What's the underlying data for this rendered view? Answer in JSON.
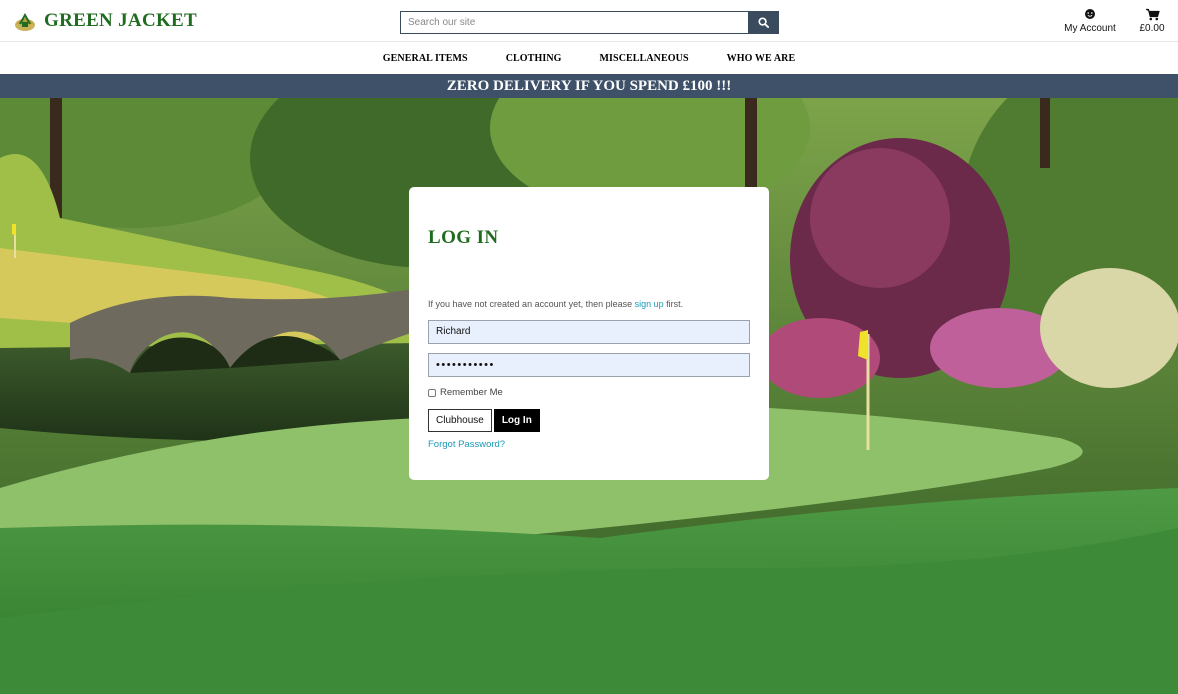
{
  "brand": {
    "name": "GREEN JACKET",
    "logo_icon": "green-jacket-logo"
  },
  "search": {
    "placeholder": "Search our site",
    "icon": "search-icon"
  },
  "account": {
    "label": "My Account",
    "icon": "user-icon"
  },
  "cart": {
    "total": "£0.00",
    "icon": "cart-icon"
  },
  "nav": {
    "items": [
      "GENERAL ITEMS",
      "CLOTHING",
      "MISCELLANEOUS",
      "WHO WE ARE"
    ]
  },
  "promo": {
    "text": "ZERO DELIVERY IF YOU SPEND £100 !!!"
  },
  "login": {
    "title": "LOG IN",
    "hint_before": "If you have not created an account yet, then please ",
    "hint_link": "sign up",
    "hint_after": " first.",
    "username_value": "Richard",
    "password_value": "•••••••••••",
    "remember_label": "Remember Me",
    "clubhouse_label": "Clubhouse",
    "login_label": "Log In",
    "forgot_label": "Forgot Password?"
  },
  "colors": {
    "brand_green": "#1f6b1f",
    "navy": "#3e5168",
    "link": "#1a9bb5"
  }
}
